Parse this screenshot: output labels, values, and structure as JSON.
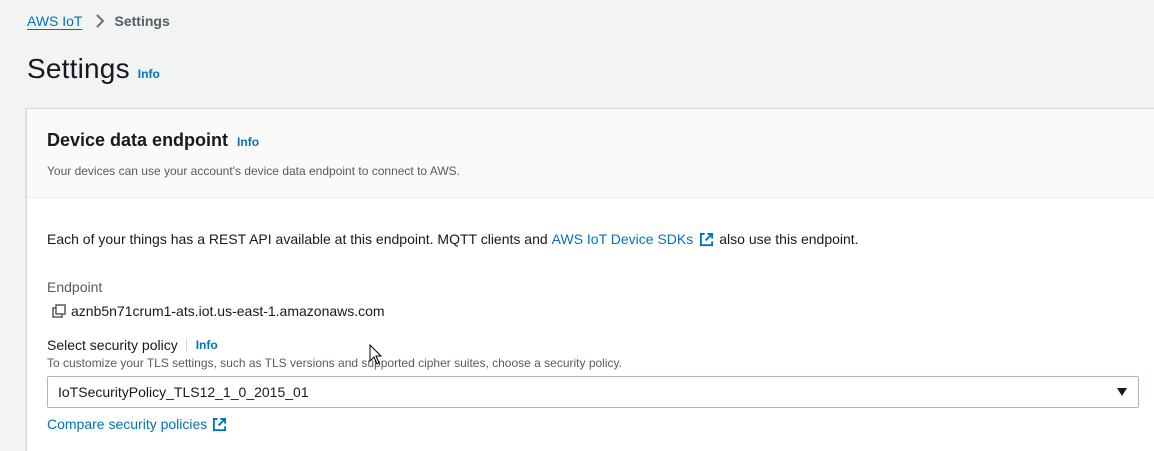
{
  "breadcrumb": {
    "root": "AWS IoT",
    "current": "Settings"
  },
  "page": {
    "title": "Settings",
    "info": "Info"
  },
  "endpoint_section": {
    "title": "Device data endpoint",
    "info": "Info",
    "description": "Your devices can use your account's device data endpoint to connect to AWS.",
    "body_prefix": "Each of your things has a REST API available at this endpoint. MQTT clients and",
    "body_link": "AWS IoT Device SDKs",
    "body_suffix": "also use this endpoint.",
    "endpoint_label": "Endpoint",
    "endpoint_value": "aznb5n71crum1-ats.iot.us-east-1.amazonaws.com",
    "policy_label": "Select security policy",
    "policy_info": "Info",
    "policy_description": "To customize your TLS settings, such as TLS versions and supported cipher suites, choose a security policy.",
    "policy_selected": "IoTSecurityPolicy_TLS12_1_0_2015_01",
    "compare_link": "Compare security policies"
  },
  "colors": {
    "link": "#0073bb",
    "text": "#16191f",
    "secondary_text": "#545b64",
    "background": "#f2f3f3"
  },
  "icons": {
    "breadcrumb_separator": "chevron-right-icon",
    "external_link": "external-link-icon",
    "copy": "copy-icon",
    "select_caret": "caret-down-icon",
    "cursor": "mouse-pointer-icon"
  }
}
